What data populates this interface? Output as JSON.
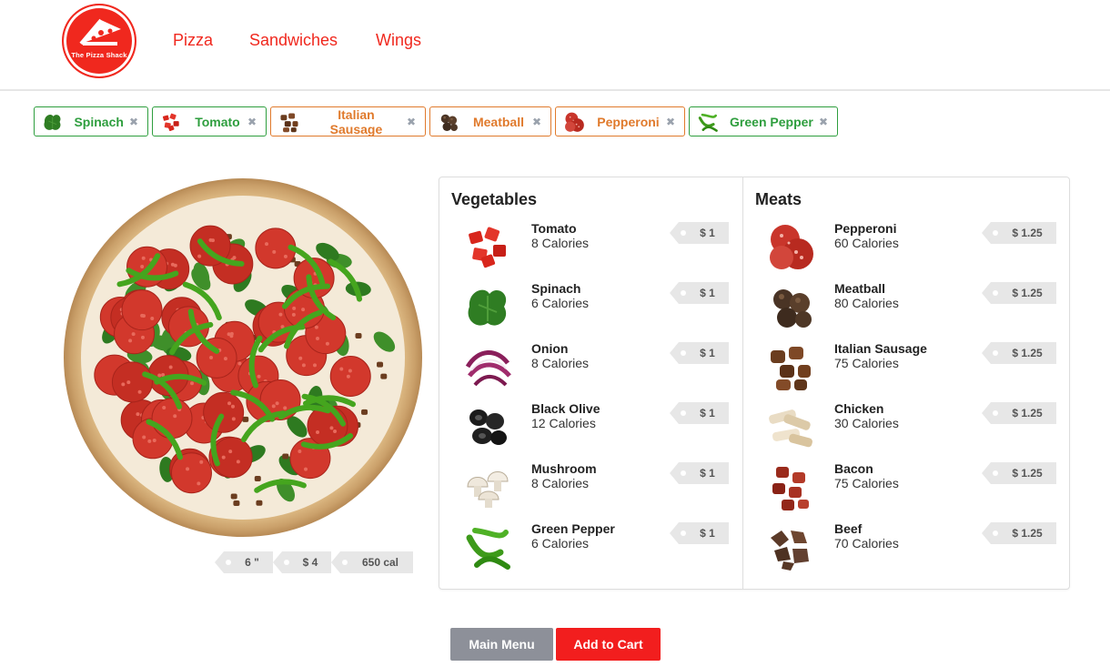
{
  "brand": {
    "logo_text": "The Pizza Shack"
  },
  "nav": [
    {
      "label": "Pizza"
    },
    {
      "label": "Sandwiches"
    },
    {
      "label": "Wings"
    }
  ],
  "selected_toppings": [
    {
      "label": "Spinach",
      "type": "veg",
      "icon": "spinach-icon"
    },
    {
      "label": "Tomato",
      "type": "veg",
      "icon": "tomato-icon"
    },
    {
      "label": "Italian Sausage",
      "type": "meat",
      "icon": "italian-sausage-icon"
    },
    {
      "label": "Meatball",
      "type": "meat",
      "icon": "meatball-icon"
    },
    {
      "label": "Pepperoni",
      "type": "meat",
      "icon": "pepperoni-icon"
    },
    {
      "label": "Green Pepper",
      "type": "veg",
      "icon": "green-pepper-icon"
    }
  ],
  "remove_glyph": "✖",
  "pizza": {
    "size": "6 \"",
    "price": "$ 4",
    "calories": "650 cal"
  },
  "vegetables": {
    "title": "Vegetables",
    "items": [
      {
        "name": "Tomato",
        "calories": "8 Calories",
        "price": "$ 1"
      },
      {
        "name": "Spinach",
        "calories": "6 Calories",
        "price": "$ 1"
      },
      {
        "name": "Onion",
        "calories": "8 Calories",
        "price": "$ 1"
      },
      {
        "name": "Black Olive",
        "calories": "12 Calories",
        "price": "$ 1"
      },
      {
        "name": "Mushroom",
        "calories": "8 Calories",
        "price": "$ 1"
      },
      {
        "name": "Green Pepper",
        "calories": "6 Calories",
        "price": "$ 1"
      }
    ]
  },
  "meats": {
    "title": "Meats",
    "items": [
      {
        "name": "Pepperoni",
        "calories": "60 Calories",
        "price": "$ 1.25"
      },
      {
        "name": "Meatball",
        "calories": "80 Calories",
        "price": "$ 1.25"
      },
      {
        "name": "Italian Sausage",
        "calories": "75 Calories",
        "price": "$ 1.25"
      },
      {
        "name": "Chicken",
        "calories": "30 Calories",
        "price": "$ 1.25"
      },
      {
        "name": "Bacon",
        "calories": "75 Calories",
        "price": "$ 1.25"
      },
      {
        "name": "Beef",
        "calories": "70 Calories",
        "price": "$ 1.25"
      }
    ]
  },
  "buttons": {
    "main_menu": "Main Menu",
    "add_to_cart": "Add to Cart"
  },
  "colors": {
    "brand_red": "#f0281e",
    "veg_green": "#2e9e3e",
    "meat_orange": "#e07a2c",
    "tag_gray": "#e7e7e7"
  }
}
